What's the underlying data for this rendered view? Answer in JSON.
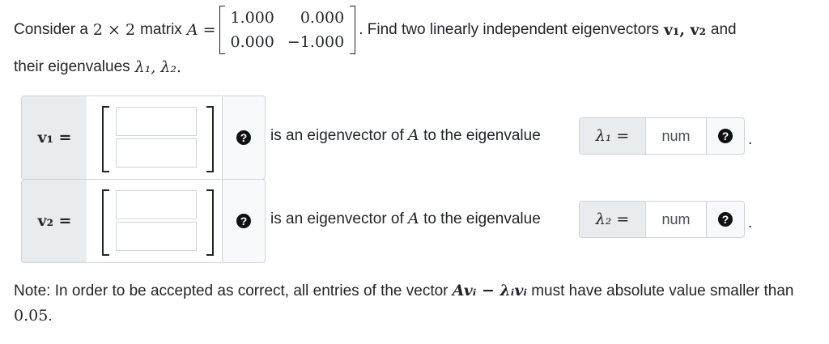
{
  "problem": {
    "consider": "Consider a",
    "dims": "2 × 2",
    "matrix_word": "matrix",
    "A_eq": "A =",
    "matrix": [
      [
        "1.000",
        "0.000"
      ],
      [
        "0.000",
        "−1.000"
      ]
    ],
    "find": ". Find two linearly independent eigenvectors",
    "v_list": "v₁, v₂",
    "and": "and",
    "line2_text": "their eigenvalues",
    "lambda_list": "λ₁, λ₂."
  },
  "rows": [
    {
      "vec_label": "v₁ =",
      "eig_text_pre": "is an eigenvector of",
      "A": "A",
      "eig_text_post": "to the eigenvalue",
      "lambda_label": "λ₁ =",
      "lambda_placeholder": "num",
      "period": "."
    },
    {
      "vec_label": "v₂ =",
      "eig_text_pre": "is an eigenvector of",
      "A": "A",
      "eig_text_post": "to the eigenvalue",
      "lambda_label": "λ₂ =",
      "lambda_placeholder": "num",
      "period": "."
    }
  ],
  "help_icon": "?",
  "note": {
    "pre": "Note: In order to be accepted as correct, all entries of the vector",
    "expr": "Avᵢ − λᵢvᵢ",
    "mid": "must have absolute value smaller than",
    "value": "0.05",
    "end": "."
  }
}
